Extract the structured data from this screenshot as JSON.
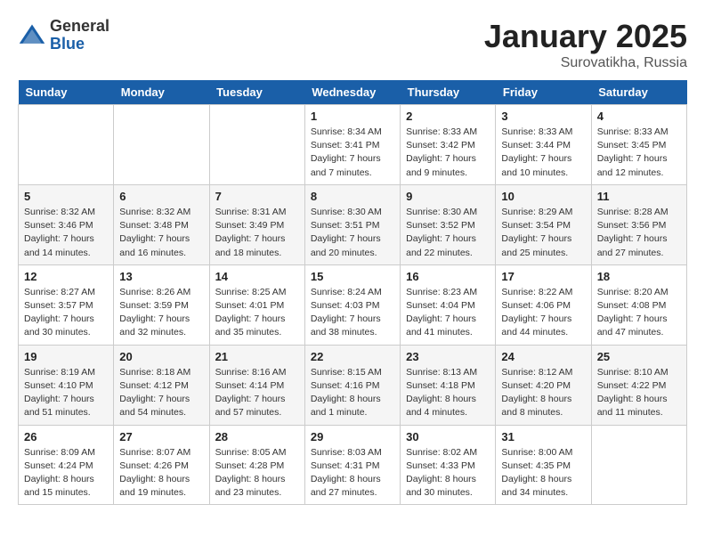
{
  "header": {
    "logo_line1": "General",
    "logo_line2": "Blue",
    "cal_title": "January 2025",
    "cal_subtitle": "Surovatikha, Russia"
  },
  "days_of_week": [
    "Sunday",
    "Monday",
    "Tuesday",
    "Wednesday",
    "Thursday",
    "Friday",
    "Saturday"
  ],
  "weeks": [
    [
      {
        "num": "",
        "info": ""
      },
      {
        "num": "",
        "info": ""
      },
      {
        "num": "",
        "info": ""
      },
      {
        "num": "1",
        "info": "Sunrise: 8:34 AM\nSunset: 3:41 PM\nDaylight: 7 hours\nand 7 minutes."
      },
      {
        "num": "2",
        "info": "Sunrise: 8:33 AM\nSunset: 3:42 PM\nDaylight: 7 hours\nand 9 minutes."
      },
      {
        "num": "3",
        "info": "Sunrise: 8:33 AM\nSunset: 3:44 PM\nDaylight: 7 hours\nand 10 minutes."
      },
      {
        "num": "4",
        "info": "Sunrise: 8:33 AM\nSunset: 3:45 PM\nDaylight: 7 hours\nand 12 minutes."
      }
    ],
    [
      {
        "num": "5",
        "info": "Sunrise: 8:32 AM\nSunset: 3:46 PM\nDaylight: 7 hours\nand 14 minutes."
      },
      {
        "num": "6",
        "info": "Sunrise: 8:32 AM\nSunset: 3:48 PM\nDaylight: 7 hours\nand 16 minutes."
      },
      {
        "num": "7",
        "info": "Sunrise: 8:31 AM\nSunset: 3:49 PM\nDaylight: 7 hours\nand 18 minutes."
      },
      {
        "num": "8",
        "info": "Sunrise: 8:30 AM\nSunset: 3:51 PM\nDaylight: 7 hours\nand 20 minutes."
      },
      {
        "num": "9",
        "info": "Sunrise: 8:30 AM\nSunset: 3:52 PM\nDaylight: 7 hours\nand 22 minutes."
      },
      {
        "num": "10",
        "info": "Sunrise: 8:29 AM\nSunset: 3:54 PM\nDaylight: 7 hours\nand 25 minutes."
      },
      {
        "num": "11",
        "info": "Sunrise: 8:28 AM\nSunset: 3:56 PM\nDaylight: 7 hours\nand 27 minutes."
      }
    ],
    [
      {
        "num": "12",
        "info": "Sunrise: 8:27 AM\nSunset: 3:57 PM\nDaylight: 7 hours\nand 30 minutes."
      },
      {
        "num": "13",
        "info": "Sunrise: 8:26 AM\nSunset: 3:59 PM\nDaylight: 7 hours\nand 32 minutes."
      },
      {
        "num": "14",
        "info": "Sunrise: 8:25 AM\nSunset: 4:01 PM\nDaylight: 7 hours\nand 35 minutes."
      },
      {
        "num": "15",
        "info": "Sunrise: 8:24 AM\nSunset: 4:03 PM\nDaylight: 7 hours\nand 38 minutes."
      },
      {
        "num": "16",
        "info": "Sunrise: 8:23 AM\nSunset: 4:04 PM\nDaylight: 7 hours\nand 41 minutes."
      },
      {
        "num": "17",
        "info": "Sunrise: 8:22 AM\nSunset: 4:06 PM\nDaylight: 7 hours\nand 44 minutes."
      },
      {
        "num": "18",
        "info": "Sunrise: 8:20 AM\nSunset: 4:08 PM\nDaylight: 7 hours\nand 47 minutes."
      }
    ],
    [
      {
        "num": "19",
        "info": "Sunrise: 8:19 AM\nSunset: 4:10 PM\nDaylight: 7 hours\nand 51 minutes."
      },
      {
        "num": "20",
        "info": "Sunrise: 8:18 AM\nSunset: 4:12 PM\nDaylight: 7 hours\nand 54 minutes."
      },
      {
        "num": "21",
        "info": "Sunrise: 8:16 AM\nSunset: 4:14 PM\nDaylight: 7 hours\nand 57 minutes."
      },
      {
        "num": "22",
        "info": "Sunrise: 8:15 AM\nSunset: 4:16 PM\nDaylight: 8 hours\nand 1 minute."
      },
      {
        "num": "23",
        "info": "Sunrise: 8:13 AM\nSunset: 4:18 PM\nDaylight: 8 hours\nand 4 minutes."
      },
      {
        "num": "24",
        "info": "Sunrise: 8:12 AM\nSunset: 4:20 PM\nDaylight: 8 hours\nand 8 minutes."
      },
      {
        "num": "25",
        "info": "Sunrise: 8:10 AM\nSunset: 4:22 PM\nDaylight: 8 hours\nand 11 minutes."
      }
    ],
    [
      {
        "num": "26",
        "info": "Sunrise: 8:09 AM\nSunset: 4:24 PM\nDaylight: 8 hours\nand 15 minutes."
      },
      {
        "num": "27",
        "info": "Sunrise: 8:07 AM\nSunset: 4:26 PM\nDaylight: 8 hours\nand 19 minutes."
      },
      {
        "num": "28",
        "info": "Sunrise: 8:05 AM\nSunset: 4:28 PM\nDaylight: 8 hours\nand 23 minutes."
      },
      {
        "num": "29",
        "info": "Sunrise: 8:03 AM\nSunset: 4:31 PM\nDaylight: 8 hours\nand 27 minutes."
      },
      {
        "num": "30",
        "info": "Sunrise: 8:02 AM\nSunset: 4:33 PM\nDaylight: 8 hours\nand 30 minutes."
      },
      {
        "num": "31",
        "info": "Sunrise: 8:00 AM\nSunset: 4:35 PM\nDaylight: 8 hours\nand 34 minutes."
      },
      {
        "num": "",
        "info": ""
      }
    ]
  ]
}
